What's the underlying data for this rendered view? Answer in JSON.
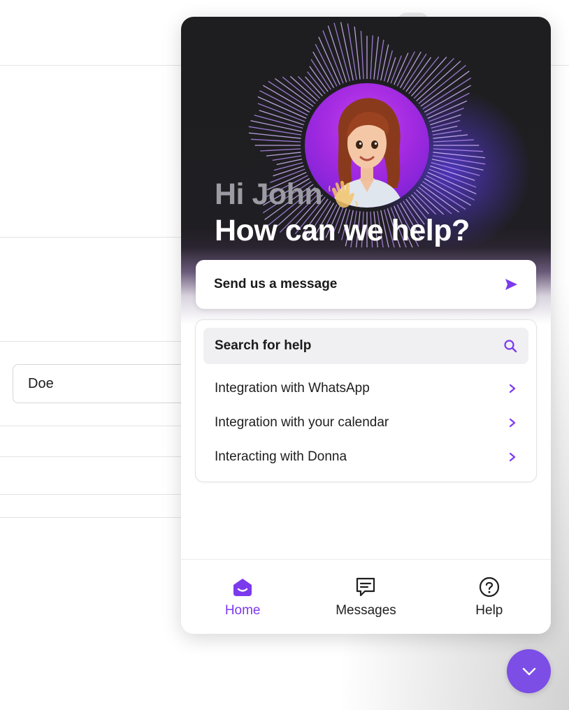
{
  "background": {
    "field_value": "Doe"
  },
  "widget": {
    "greeting": "Hi John",
    "headline": "How can we help?",
    "send_message_label": "Send us a message",
    "search_label": "Search for help",
    "articles": [
      {
        "label": "Integration with WhatsApp"
      },
      {
        "label": "Integration with your calendar"
      },
      {
        "label": "Interacting with Donna"
      }
    ],
    "tabs": [
      {
        "label": "Home",
        "icon": "home-icon",
        "active": true
      },
      {
        "label": "Messages",
        "icon": "messages-icon",
        "active": false
      },
      {
        "label": "Help",
        "icon": "help-icon",
        "active": false
      }
    ]
  },
  "colors": {
    "accent": "#7c3aed",
    "launcher": "#7c4ee6",
    "hero_dark": "#1e1e20"
  }
}
